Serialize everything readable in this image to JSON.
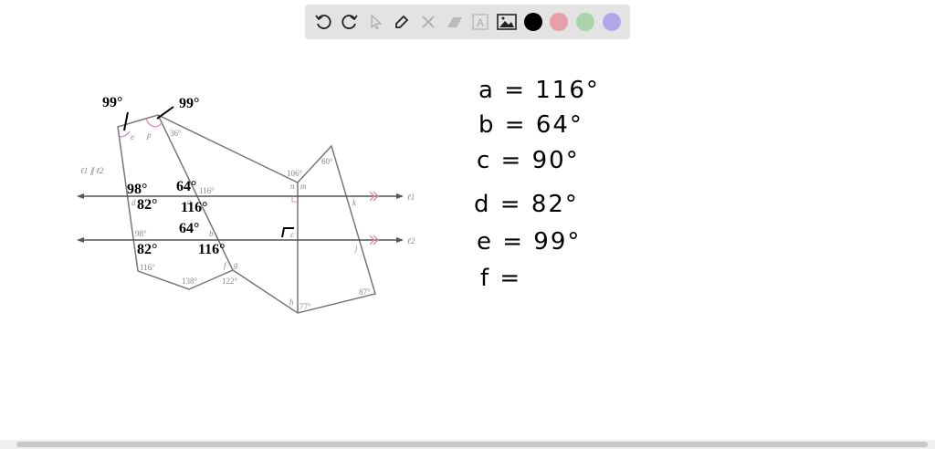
{
  "toolbar": {
    "tools": [
      "undo-icon",
      "redo-icon",
      "select-icon",
      "pen-icon",
      "tools-icon",
      "eraser-icon",
      "text-icon",
      "image-icon"
    ],
    "colors": [
      "#000000",
      "#e8a0a8",
      "#a8d4a8",
      "#b0a8e8"
    ]
  },
  "diagram": {
    "parallel_note": "ℓ1 ∥ ℓ2",
    "l1": "ℓ1",
    "l2": "ℓ2",
    "printed": {
      "p": "p",
      "e": "e",
      "a36": "36°",
      "a106": "106°",
      "n": "n",
      "m": "m",
      "a60": "60°",
      "a116top": "116°",
      "a": "a",
      "d": "d",
      "k": "k",
      "a98": "98°",
      "b": "b",
      "c": "c",
      "j": "j",
      "a116bot": "116°",
      "f": "f",
      "g": "g",
      "a138": "138°",
      "a122": "122°",
      "h": "h",
      "a77": "77°",
      "a87": "87°"
    },
    "handwritten": {
      "e99": "99°",
      "p99": "99°",
      "d98": "98°",
      "d82": "82°",
      "a64": "64°",
      "a116": "116°",
      "b64": "64°",
      "b116": "116°",
      "l2_98": "82°"
    }
  },
  "answers": [
    "a = 116°",
    "b = 64°",
    "c = 90°",
    "d = 82°",
    "e = 99°",
    "f ="
  ]
}
